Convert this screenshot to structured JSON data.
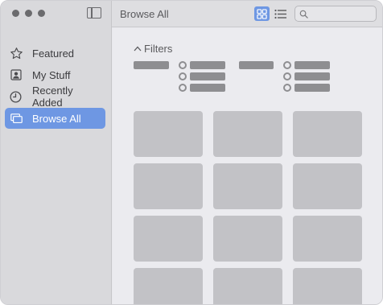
{
  "window": {
    "title": "Browse All"
  },
  "sidebar": {
    "items": [
      {
        "label": "Featured",
        "icon": "star-icon",
        "active": false
      },
      {
        "label": "My Stuff",
        "icon": "person-icon",
        "active": false
      },
      {
        "label": "Recently Added",
        "icon": "clock-icon",
        "active": false
      },
      {
        "label": "Browse All",
        "icon": "browse-icon",
        "active": true
      }
    ]
  },
  "toolbar": {
    "title": "Browse All",
    "view_mode": "grid",
    "search_placeholder": ""
  },
  "filters": {
    "title": "Filters",
    "expanded": true,
    "groups": [
      {
        "option_count": 3
      },
      {
        "option_count": 3
      }
    ]
  },
  "colors": {
    "accent": "#6e97e3",
    "sidebar_bg": "#d9d9dc",
    "content_bg": "#ebebef",
    "tile": "#c2c2c6",
    "placeholder_gray": "#8e8e91"
  }
}
